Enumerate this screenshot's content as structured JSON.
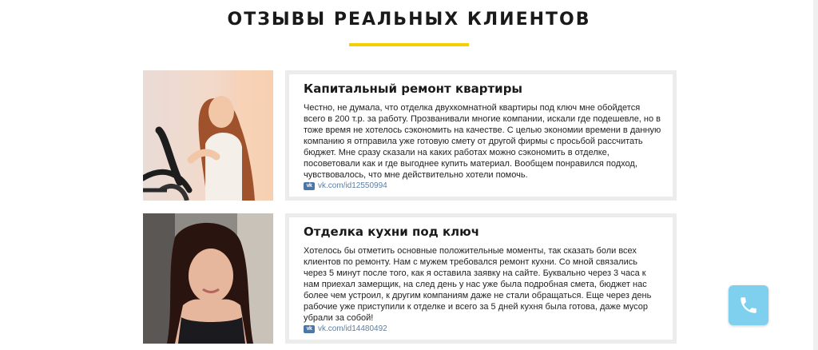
{
  "section": {
    "title": "ОТЗЫВЫ РЕАЛЬНЫХ КЛИЕНТОВ"
  },
  "colors": {
    "accent": "#f4d000",
    "card_border": "#ececec",
    "link": "#5b7fa6",
    "call_button": "#7fd0ee"
  },
  "reviews": [
    {
      "title": "Капитальный ремонт квартиры",
      "text": "Честно, не думала, что отделка двухкомнатной квартиры под ключ мне обойдется всего в 200 т.р. за работу. Прозванивали многие компании, искали где подешевле, но в тоже время не хотелось сэкономить на качестве. С целью экономии времени в данную компанию я отправила уже готовую смету от другой фирмы с просьбой рассчитать бюджет. Мне сразу сказали на каких работах можно сэкономить в отделке, посоветовали как и где выгоднее купить материал. Вообщем понравился подход, чувствовалось, что мне действительно хотели помочь.",
      "vk_link": "vk.com/id12550994",
      "vk_icon": "vk-icon"
    },
    {
      "title": "Отделка кухни под ключ",
      "text": "Хотелось бы отметить основные положительные моменты, так сказать боли всех клиентов по ремонту. Нам с мужем требовался ремонт кухни. Со мной связались через 5 минут после того, как я оставила заявку на сайте. Буквально через 3 часа к нам приехал замерщик, на след день у нас уже была подробная смета, бюджет нас более чем устроил, к другим компаниям даже не стали обращаться. Еще через день рабочие уже приступили к отделке и всего за 5 дней кухня была готова, даже мусор убрали за собой!",
      "vk_link": "vk.com/id14480492",
      "vk_icon": "vk-icon"
    }
  ],
  "call_button": {
    "icon": "phone-icon"
  }
}
